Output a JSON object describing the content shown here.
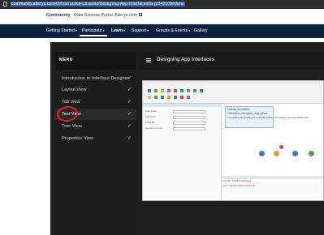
{
  "browser": {
    "url_host": "community.alteryx.com",
    "url_path": "/t5/Interactive-Lessons/Designing-App-Interfaces/ta-p/243109#done"
  },
  "topnav": {
    "links": [
      "Community",
      "Data Science Portal",
      "Alteryx.com"
    ]
  },
  "mainnav": {
    "items": [
      "Getting Started",
      "Participate",
      "Learn",
      "Support",
      "Groups & Events",
      "Gallery"
    ],
    "active_item": "Participate"
  },
  "menu": {
    "title": "MENU",
    "items": [
      {
        "label": "Introduction to Interface Designer",
        "checked": true
      },
      {
        "label": "Layout View",
        "checked": true
      },
      {
        "label": "Tab View",
        "checked": true
      },
      {
        "label": "Test View",
        "checked": true
      },
      {
        "label": "Tree View",
        "checked": true
      },
      {
        "label": "Properties View",
        "checked": true
      }
    ],
    "active_item": "Test View",
    "highlight_color": "#e8211a"
  },
  "content": {
    "title": "Designing App Interfaces"
  },
  "designer": {
    "workflow_title": "Debug Workflow",
    "workflow_file": "interface_designer_app.yxwz",
    "workflow_text_1": "This workflow was generated by running the interface with changes to the tool as shown below.",
    "workflow_text_2": "",
    "properties": [
      "Input Values",
      "Drop Down",
      "Check Box",
      "Numeric Up Down"
    ],
    "results_tabs": "Results - Workflow Messages",
    "results_error": "Error - Tool #2: Unable to find the file..."
  },
  "colors": {
    "nav_dark": "#0c2340",
    "page_dark": "#1f1f1f",
    "accent_red": "#e8211a"
  }
}
